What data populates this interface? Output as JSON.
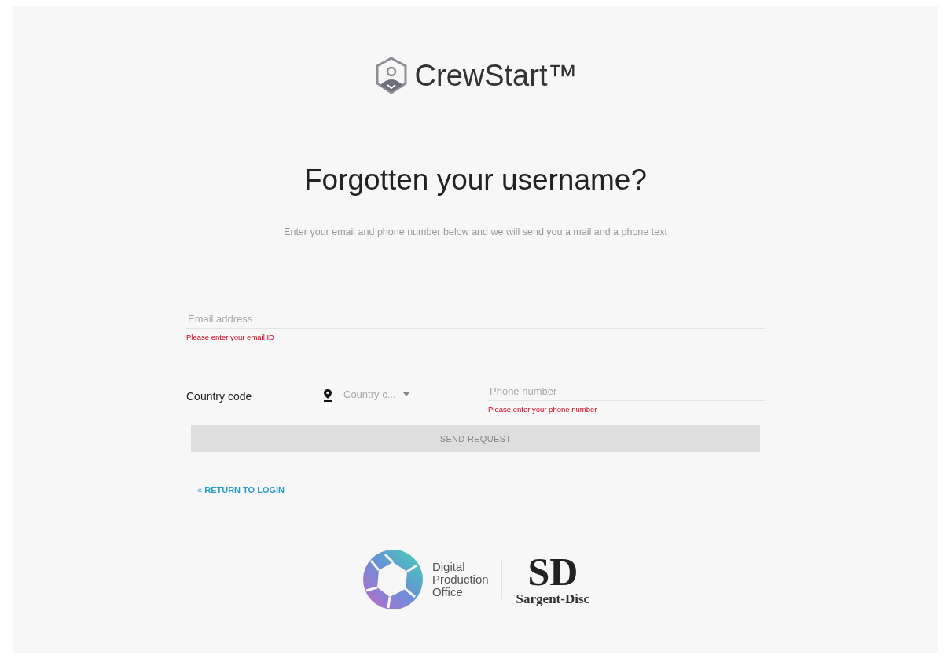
{
  "brand": {
    "name": "CrewStart™"
  },
  "heading": "Forgotten your username?",
  "subtitle": "Enter your email and phone number below and we will send you a mail and a phone text",
  "email": {
    "placeholder": "Email address",
    "error": "Please enter your email ID"
  },
  "country": {
    "label": "Country code",
    "placeholder": "Country c..."
  },
  "phone": {
    "placeholder": "Phone number",
    "error": "Please enter your phone number"
  },
  "submit": {
    "label": "SEND REQUEST",
    "disabled": true
  },
  "back_link": {
    "arrow": "«",
    "label": "RETURN TO LOGIN"
  },
  "footer": {
    "dpo_lines": [
      "Digital",
      "Production",
      "Office"
    ],
    "sd_letters": "SD",
    "sd_name": "Sargent-Disc"
  }
}
